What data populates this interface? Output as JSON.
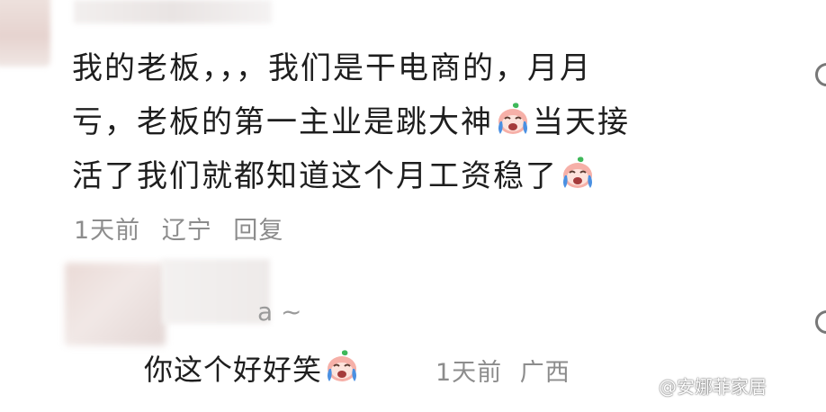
{
  "comment": {
    "line1": "我的老板，，，我们是干电商的，月月",
    "line2_a": "亏，老板的第一主业是跳大神",
    "line2_b": "当天接",
    "line3_a": "活了我们就都知道这个月工资稳了",
    "time": "1天前",
    "location": "辽宁",
    "reply_label": "回复"
  },
  "reply": {
    "username_tail": "a ~",
    "text": "你这个好好笑",
    "time": "1天前",
    "location_partial": "广西"
  },
  "watermark": "@安娜菲家居",
  "icons": {
    "emoji": "crying-face-emoji",
    "side": "circle-more-icon"
  },
  "colors": {
    "text": "#1e1e1e",
    "meta": "#8c8c8c",
    "emoji_face": "#f6b0a8",
    "emoji_tear": "#4a90e2",
    "emoji_leaf": "#3fb85a"
  }
}
